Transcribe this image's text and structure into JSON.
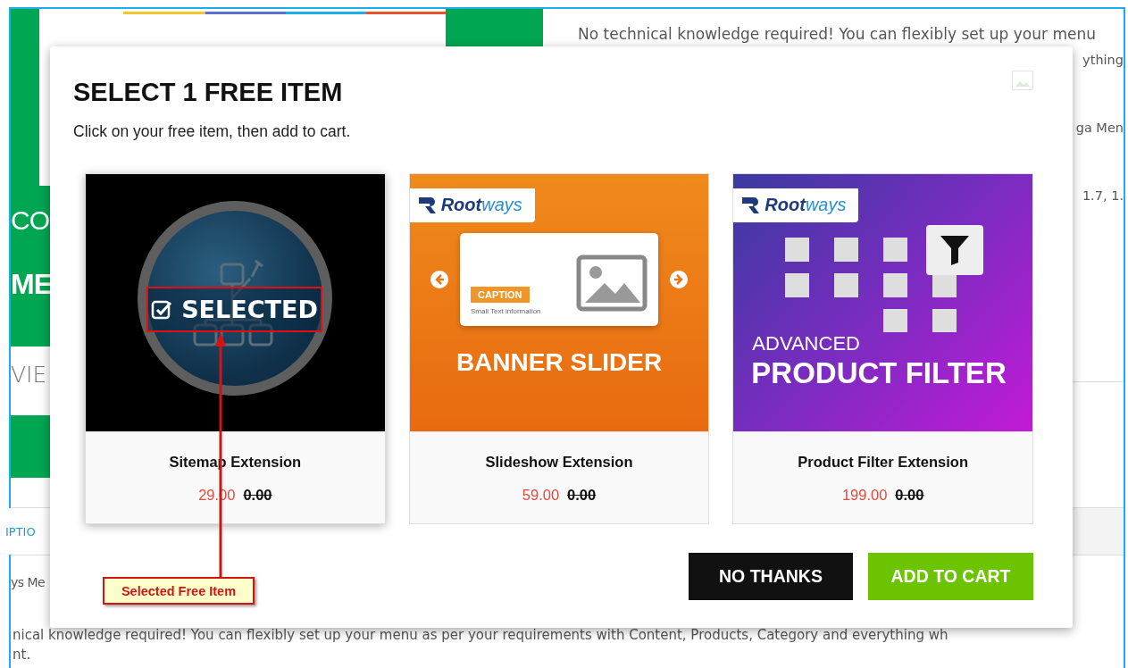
{
  "background": {
    "banner": {
      "fragments": [
        "CO",
        "ME"
      ]
    },
    "intro_text": "No technical knowledge required! You can flexibly set up your menu",
    "right_fragments": [
      "ything",
      "ga Men",
      "1.7, 1."
    ],
    "reviews_fragment": "VIE",
    "tab_fragment": "IPTIO",
    "heading_fragment": "ys Me",
    "body_lines": [
      "nical knowledge required! You can flexibly set up your menu as per your requirements with Content, Products, Category and everything wh",
      "nt."
    ]
  },
  "modal": {
    "title": "SELECT 1 FREE ITEM",
    "subtitle": "Click on your free item, then add to cart.",
    "selected_label": "SELECTED",
    "items": [
      {
        "name": "Sitemap Extension",
        "price": "29.00",
        "free_price": "0.00",
        "selected": true,
        "image": {
          "kind": "sitemap"
        }
      },
      {
        "name": "Slideshow Extension",
        "price": "59.00",
        "free_price": "0.00",
        "selected": false,
        "image": {
          "kind": "banner-slider",
          "logo": "**Root**ways",
          "caption": "CAPTION",
          "caption_note": "Small Text information",
          "headline": "BANNER SLIDER"
        }
      },
      {
        "name": "Product Filter Extension",
        "price": "199.00",
        "free_price": "0.00",
        "selected": false,
        "image": {
          "kind": "product-filter",
          "logo": "**Root**ways",
          "overline": "ADVANCED",
          "headline": "PRODUCT FILTER"
        }
      }
    ],
    "buttons": [
      {
        "label": "NO THANKS",
        "kind": "dark"
      },
      {
        "label": "ADD TO CART",
        "kind": "primary"
      }
    ]
  },
  "annotation": {
    "label": "Selected Free Item"
  }
}
